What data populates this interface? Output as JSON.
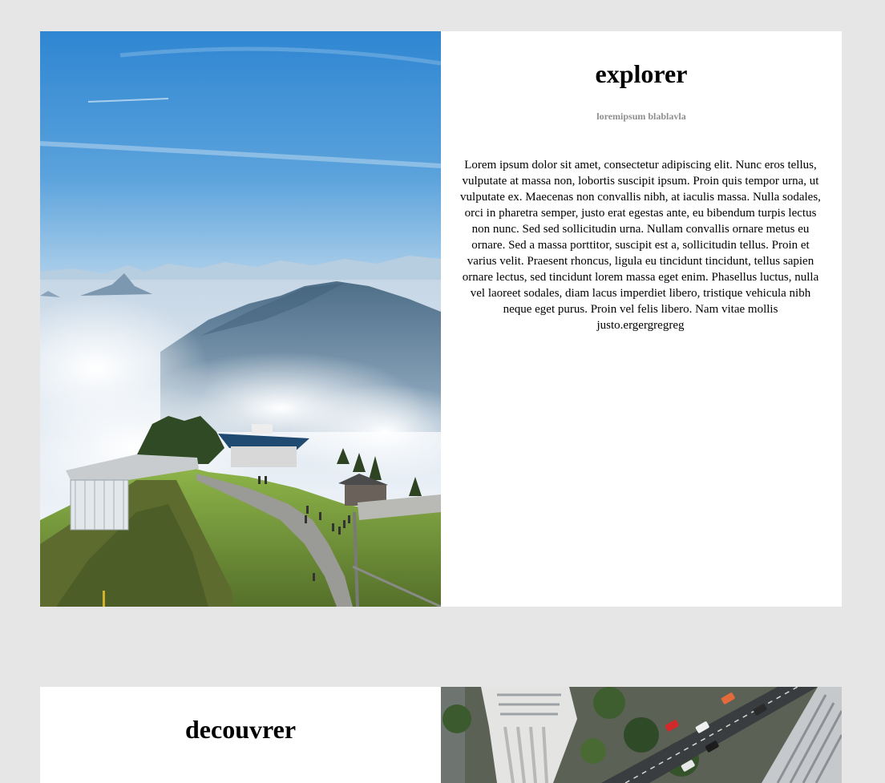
{
  "sections": [
    {
      "title": "explorer",
      "subtitle": "loremipsum blablavla",
      "body": "Lorem ipsum dolor sit amet, consectetur adipiscing elit. Nunc eros tellus, vulputate at massa non, lobortis suscipit ipsum. Proin quis tempor urna, ut vulputate ex. Maecenas non convallis nibh, at iaculis massa. Nulla sodales, orci in pharetra semper, justo erat egestas ante, eu bibendum turpis lectus non nunc. Sed sed sollicitudin urna. Nullam convallis ornare metus eu ornare. Sed a massa porttitor, suscipit est a, sollicitudin tellus. Proin et varius velit. Praesent rhoncus, ligula eu tincidunt tincidunt, tellus sapien ornare lectus, sed tincidunt lorem massa eget enim. Phasellus luctus, nulla vel laoreet sodales, diam lacus imperdiet libero, tristique vehicula nibh neque eget purus. Proin vel felis libero. Nam vitae mollis justo.ergergregreg",
      "image": "mountain-summit-photo"
    },
    {
      "title": "decouvrer",
      "image": "city-aerial-photo"
    }
  ],
  "colors": {
    "page_background": "#e6e6e6",
    "card_background": "#ffffff",
    "subtitle": "#8e8e8e"
  }
}
